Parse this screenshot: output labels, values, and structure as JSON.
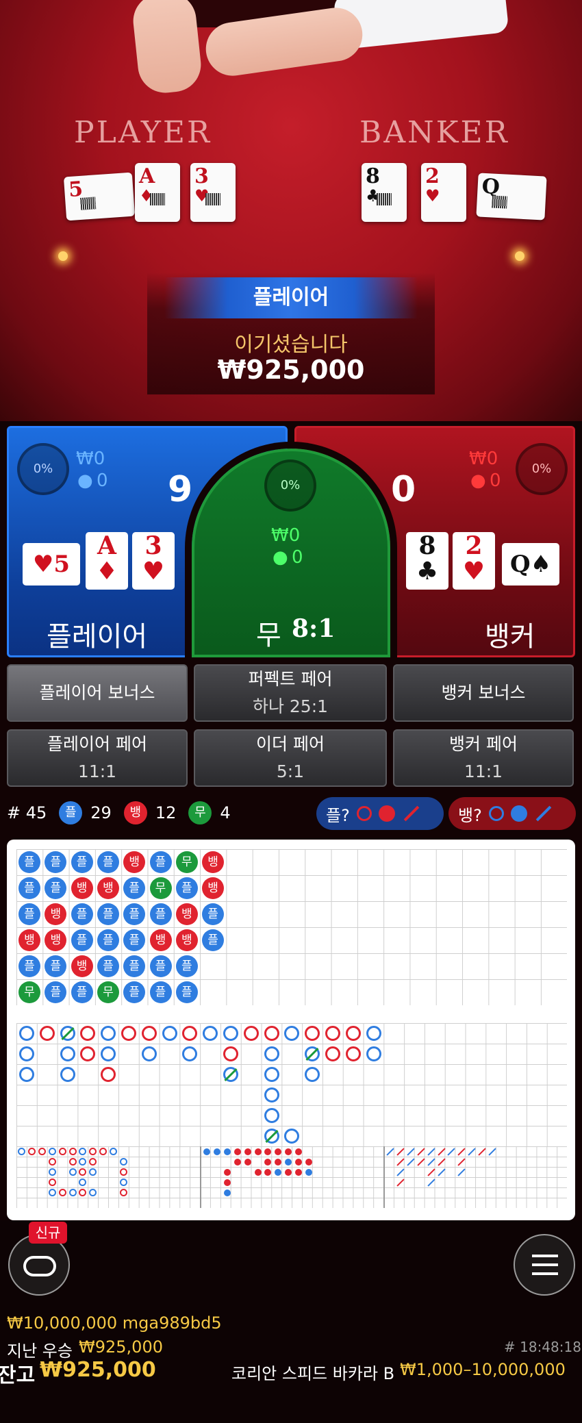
{
  "table": {
    "player_label": "PLAYER",
    "banker_label": "BANKER",
    "player_cards": [
      {
        "rank": "5",
        "suit": "♥",
        "color": "red"
      },
      {
        "rank": "A",
        "suit": "♦",
        "color": "red"
      },
      {
        "rank": "3",
        "suit": "♥",
        "color": "red"
      }
    ],
    "banker_cards": [
      {
        "rank": "8",
        "suit": "♣",
        "color": "black"
      },
      {
        "rank": "2",
        "suit": "♥",
        "color": "red"
      },
      {
        "rank": "Q",
        "suit": "♠",
        "color": "black"
      }
    ]
  },
  "result": {
    "banner": "플레이어",
    "message": "이기셨습니다",
    "amount": "₩925,000"
  },
  "bets": {
    "player": {
      "percent": "0%",
      "amount": "₩0",
      "users": "0",
      "score": "9",
      "label": "플레이어",
      "color": "#1d6ee0"
    },
    "banker": {
      "percent": "0%",
      "amount": "₩0",
      "users": "0",
      "score": "0",
      "label": "뱅커",
      "color": "#b01420"
    },
    "tie": {
      "percent": "0%",
      "amount": "₩0",
      "users": "0",
      "label": "무",
      "payout": "8:1",
      "color": "#107a2a"
    },
    "side": [
      {
        "label": "플레이어 보너스",
        "sub": ""
      },
      {
        "label": "퍼펙트 페어",
        "sub": "하나 25:1"
      },
      {
        "label": "뱅커 보너스",
        "sub": ""
      },
      {
        "label": "플레이어 페어",
        "sub": "11:1"
      },
      {
        "label": "이더 페어",
        "sub": "5:1"
      },
      {
        "label": "뱅커 페어",
        "sub": "11:1"
      }
    ]
  },
  "stats": {
    "round": "# 45",
    "player_badge": "플",
    "player_count": "29",
    "banker_badge": "뱅",
    "banker_count": "12",
    "tie_badge": "무",
    "tie_count": "4",
    "ask_player": "플?",
    "ask_banker": "뱅?"
  },
  "bead_road": [
    [
      "플",
      "플",
      "플",
      "플",
      "뱅",
      "플",
      "무",
      "뱅"
    ],
    [
      "플",
      "플",
      "뱅",
      "뱅",
      "플",
      "무",
      "플",
      "뱅"
    ],
    [
      "플",
      "뱅",
      "플",
      "플",
      "플",
      "플",
      "뱅",
      "플"
    ],
    [
      "뱅",
      "뱅",
      "플",
      "플",
      "플",
      "뱅",
      "뱅",
      "플"
    ],
    [
      "플",
      "플",
      "뱅",
      "플",
      "플",
      "플",
      "플",
      ""
    ],
    [
      "무",
      "플",
      "플",
      "무",
      "플",
      "플",
      "플",
      ""
    ]
  ],
  "colors": {
    "player": "#2f7de0",
    "banker": "#e0232f",
    "tie": "#1c9a3c",
    "gold": "#f6c945"
  },
  "footer": {
    "new_badge": "신규",
    "limit_user": "₩10,000,000 mga989bd5",
    "last_win_label": "지난 우승",
    "last_win_amount": "₩925,000",
    "balance_label": "잔고",
    "balance_amount": "₩925,000",
    "time": "# 18:48:18",
    "game_name": "코리안 스피드 바카라 B",
    "game_limits": "₩1,000–10,000,000"
  }
}
